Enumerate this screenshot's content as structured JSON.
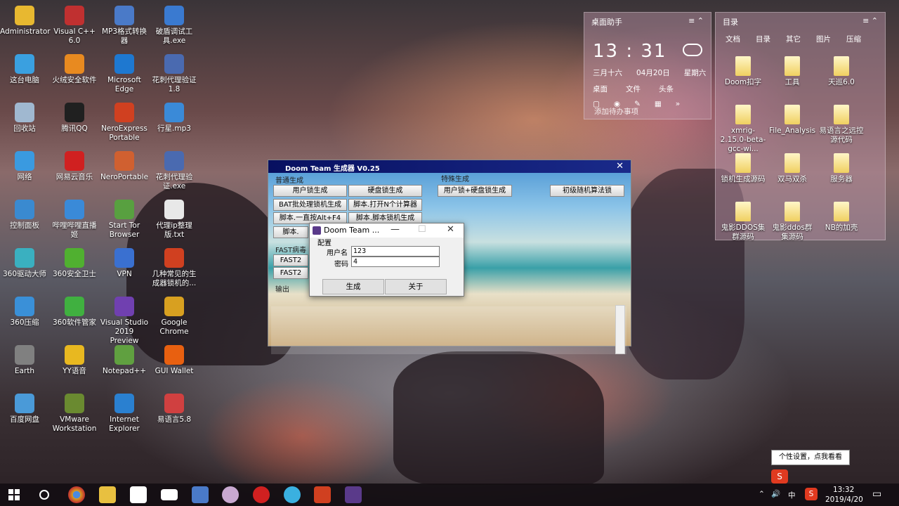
{
  "desktop_icons": [
    {
      "label": "Administrator",
      "icon": "user-folder-icon",
      "color": "#e8b830"
    },
    {
      "label": "Visual C++ 6.0",
      "icon": "visual-cpp-icon",
      "color": "#c03030"
    },
    {
      "label": "MP3格式转换器",
      "icon": "mp3-converter-icon",
      "color": "#4a7ac8"
    },
    {
      "label": "破盾调试工具.exe",
      "icon": "exe-window-icon",
      "color": "#3a7ad0"
    },
    {
      "label": "这台电脑",
      "icon": "computer-icon",
      "color": "#3aa0e0"
    },
    {
      "label": "火绒安全软件",
      "icon": "huorong-icon",
      "color": "#e88a20"
    },
    {
      "label": "Microsoft Edge",
      "icon": "edge-icon",
      "color": "#1e78d0"
    },
    {
      "label": "花刺代理验证1.8",
      "icon": "proxy-tool-icon",
      "color": "#4a6ab0"
    },
    {
      "label": "回收站",
      "icon": "recycle-bin-icon",
      "color": "#a0b8d0"
    },
    {
      "label": "腾讯QQ",
      "icon": "qq-icon",
      "color": "#202020"
    },
    {
      "label": "NeroExpress Portable",
      "icon": "nero-icon",
      "color": "#d04020"
    },
    {
      "label": "行星.mp3",
      "icon": "audio-file-icon",
      "color": "#3a8ad8"
    },
    {
      "label": "网络",
      "icon": "network-icon",
      "color": "#3a9ae0"
    },
    {
      "label": "网易云音乐",
      "icon": "netease-music-icon",
      "color": "#d02020"
    },
    {
      "label": "NeroPortable",
      "icon": "nero-portable-icon",
      "color": "#d06030"
    },
    {
      "label": "花刺代理验证.exe",
      "icon": "proxy-exe-icon",
      "color": "#4a6ab0"
    },
    {
      "label": "控制面板",
      "icon": "control-panel-icon",
      "color": "#3a8ad0"
    },
    {
      "label": "哔哩哔哩直播姬",
      "icon": "bilibili-live-icon",
      "color": "#3a8ad8"
    },
    {
      "label": "Start Tor Browser",
      "icon": "tor-icon",
      "color": "#58a040"
    },
    {
      "label": "代理ip整理版.txt",
      "icon": "text-file-icon",
      "color": "#e8e8e8"
    },
    {
      "label": "360驱动大师",
      "icon": "driver-master-icon",
      "color": "#3ab0c0"
    },
    {
      "label": "360安全卫士",
      "icon": "360-safe-icon",
      "color": "#50b030"
    },
    {
      "label": "VPN",
      "icon": "vpn-icon",
      "color": "#3a70d0"
    },
    {
      "label": "几种常见的生成器锁机的...",
      "icon": "ppt-file-icon",
      "color": "#d04020"
    },
    {
      "label": "360压缩",
      "icon": "zip-icon",
      "color": "#3a90d8"
    },
    {
      "label": "360软件管家",
      "icon": "software-manager-icon",
      "color": "#40b040"
    },
    {
      "label": "Visual Studio 2019 Preview",
      "icon": "visual-studio-icon",
      "color": "#7040b0"
    },
    {
      "label": "Google Chrome",
      "icon": "chrome-icon",
      "color": "#d8a020"
    },
    {
      "label": "Earth",
      "icon": "earth-icon",
      "color": "#808080"
    },
    {
      "label": "YY语音",
      "icon": "yy-icon",
      "color": "#e8b820"
    },
    {
      "label": "Notepad++",
      "icon": "notepad-plus-icon",
      "color": "#60a040"
    },
    {
      "label": "GUI Wallet",
      "icon": "monero-wallet-icon",
      "color": "#e86010"
    },
    {
      "label": "百度网盘",
      "icon": "baidu-netdisk-icon",
      "color": "#4a9ad8"
    },
    {
      "label": "VMware Workstation",
      "icon": "vmware-icon",
      "color": "#6a8a30"
    },
    {
      "label": "Internet Explorer",
      "icon": "ie-icon",
      "color": "#2a80d0"
    },
    {
      "label": "易语言5.8",
      "icon": "eyuyan-icon",
      "color": "#d04040"
    }
  ],
  "widget_assistant": {
    "title": "桌面助手",
    "time": "13 : 31",
    "lunar": "三月十六",
    "date": "04月20日",
    "weekday": "星期六",
    "items": [
      "桌面",
      "文件",
      "头条"
    ],
    "todo": "添加待办事项"
  },
  "widget_dir": {
    "title": "目录",
    "tabs": [
      "文档",
      "目录",
      "其它",
      "图片",
      "压缩"
    ],
    "files": [
      "Doom扣字",
      "工具",
      "天巡6.0",
      "xmrig-2.15.0-beta-gcc-wi...",
      "File_Analysis",
      "易语言之远控源代码",
      "锁机生成源码",
      "双马双杀",
      "服务器",
      "鬼影DDOS集群源码",
      "鬼影ddos群集源码",
      "NB的加壳"
    ]
  },
  "app_window": {
    "title": "Doom Team 生成器 V0.25",
    "group_normal": "普通生成",
    "group_special": "特殊生成",
    "group_fast": "FAST病毒",
    "output_label": "输出",
    "buttons": [
      "用户锁生成",
      "硬盘锁生成",
      "BAT批处理锁机生成",
      "脚本.打开N个计算器",
      "脚本.一直按Alt+F4",
      "脚本.脚本锁机生成",
      "脚本.",
      "FAST2",
      "FAST2"
    ],
    "special_buttons": [
      "用户锁+硬盘锁生成",
      "初级随机算法锁"
    ]
  },
  "dialog": {
    "title": "Doom Team ...",
    "group": "配置",
    "username_label": "用户名",
    "username_value": "123",
    "password_label": "密码",
    "password_value": "4",
    "generate": "生成",
    "about": "关于"
  },
  "taskbar": {
    "ime": "中",
    "time": "13:32",
    "date": "2019/4/20",
    "tooltip": "个性设置，点我看看"
  }
}
